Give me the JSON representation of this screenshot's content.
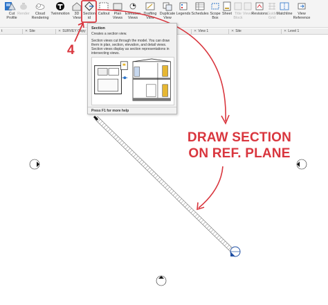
{
  "ribbon": {
    "buttons": [
      {
        "name": "modify",
        "label": ""
      },
      {
        "name": "cut-profile",
        "label": "Cut\nProfile"
      },
      {
        "name": "render",
        "label": "Render"
      },
      {
        "name": "cloud-rendering",
        "label": "Cloud\nRendering"
      },
      {
        "name": "twinmotion",
        "label": "Twinmotion"
      },
      {
        "name": "3d-view",
        "label": "3D\nView"
      },
      {
        "name": "section",
        "label": "Section\nid"
      },
      {
        "name": "callout",
        "label": "Callout"
      },
      {
        "name": "plan-views",
        "label": "Plan\nViews"
      },
      {
        "name": "elevation",
        "label": "Elevation\nViews"
      },
      {
        "name": "drafting-view",
        "label": "Drafting\nView"
      },
      {
        "name": "duplicate-view",
        "label": "Duplicate\nView"
      },
      {
        "name": "legends",
        "label": "Legends"
      },
      {
        "name": "schedules",
        "label": "Schedules"
      },
      {
        "name": "scope-box",
        "label": "Scope\nBox"
      },
      {
        "name": "sheet",
        "label": "Sheet"
      },
      {
        "name": "title-block",
        "label": "Title\nBlock"
      },
      {
        "name": "views",
        "label": "Views"
      },
      {
        "name": "revisions",
        "label": "Revisions"
      },
      {
        "name": "guide-grid",
        "label": "Guide\nGrid"
      },
      {
        "name": "matchline",
        "label": "Matchline"
      },
      {
        "name": "view-reference",
        "label": "View\nReference"
      }
    ]
  },
  "tabs": [
    {
      "label": "t"
    },
    {
      "label": "Site"
    },
    {
      "label": "SURVEY Copy"
    },
    {
      "label": "View 1"
    },
    {
      "label": "Site"
    },
    {
      "label": "Level 1"
    }
  ],
  "tooltip": {
    "title": "Section",
    "line1": "Creates a section view.",
    "description": "Section views cut through the model. You can draw them in plan, section, elevation, and detail views. Section views display as section representations in intersecting views.",
    "help": "Press F1 for more help"
  },
  "annotations": {
    "step_number": "4",
    "callout_line1": "DRAW SECTION",
    "callout_line2": "ON REF. PLANE",
    "accent_color": "#d9363e"
  }
}
